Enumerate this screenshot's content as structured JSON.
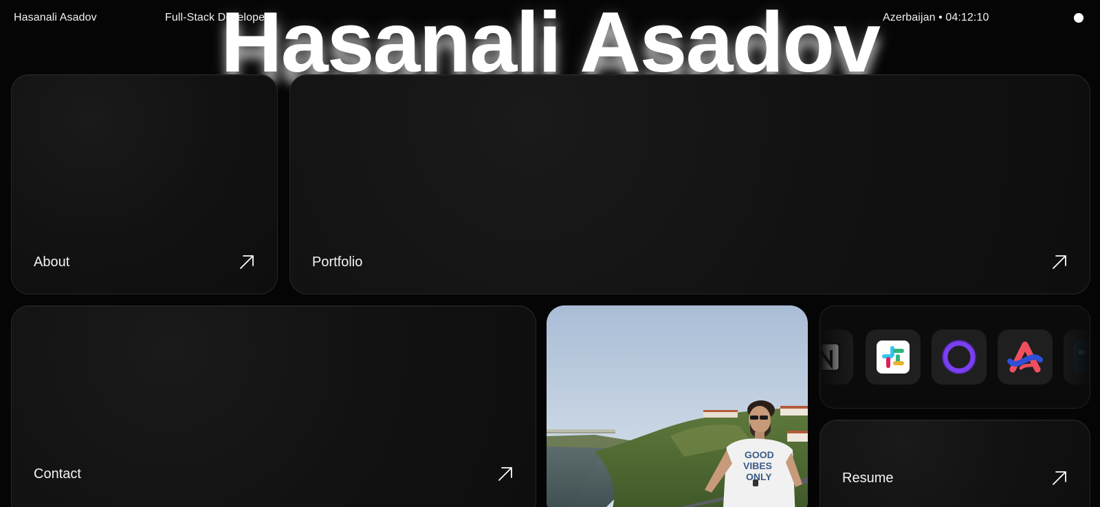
{
  "header": {
    "name": "Hasanali Asadov",
    "role": "Full-Stack Developer",
    "location_time": "Azerbaijan • 04:12:10"
  },
  "hero": {
    "title": "Hasanali Asadov"
  },
  "cards": {
    "about": {
      "label": "About",
      "icon": "arrow-up-right-icon"
    },
    "portfolio": {
      "label": "Portfolio",
      "icon": "arrow-up-right-icon"
    },
    "contact": {
      "label": "Contact",
      "icon": "arrow-up-right-icon"
    },
    "resume": {
      "label": "Resume",
      "icon": "arrow-up-right-icon"
    }
  },
  "photo": {
    "tshirt_text": [
      "GOOD",
      "VIBES",
      "ONLY"
    ]
  },
  "tools": {
    "icons": [
      "notion-icon",
      "slack-icon",
      "ring-app-icon",
      "arc-style-logo-icon",
      "partial-app-icon"
    ]
  },
  "colors": {
    "background": "#050505",
    "card": "#121212",
    "text": "#ffffff"
  }
}
